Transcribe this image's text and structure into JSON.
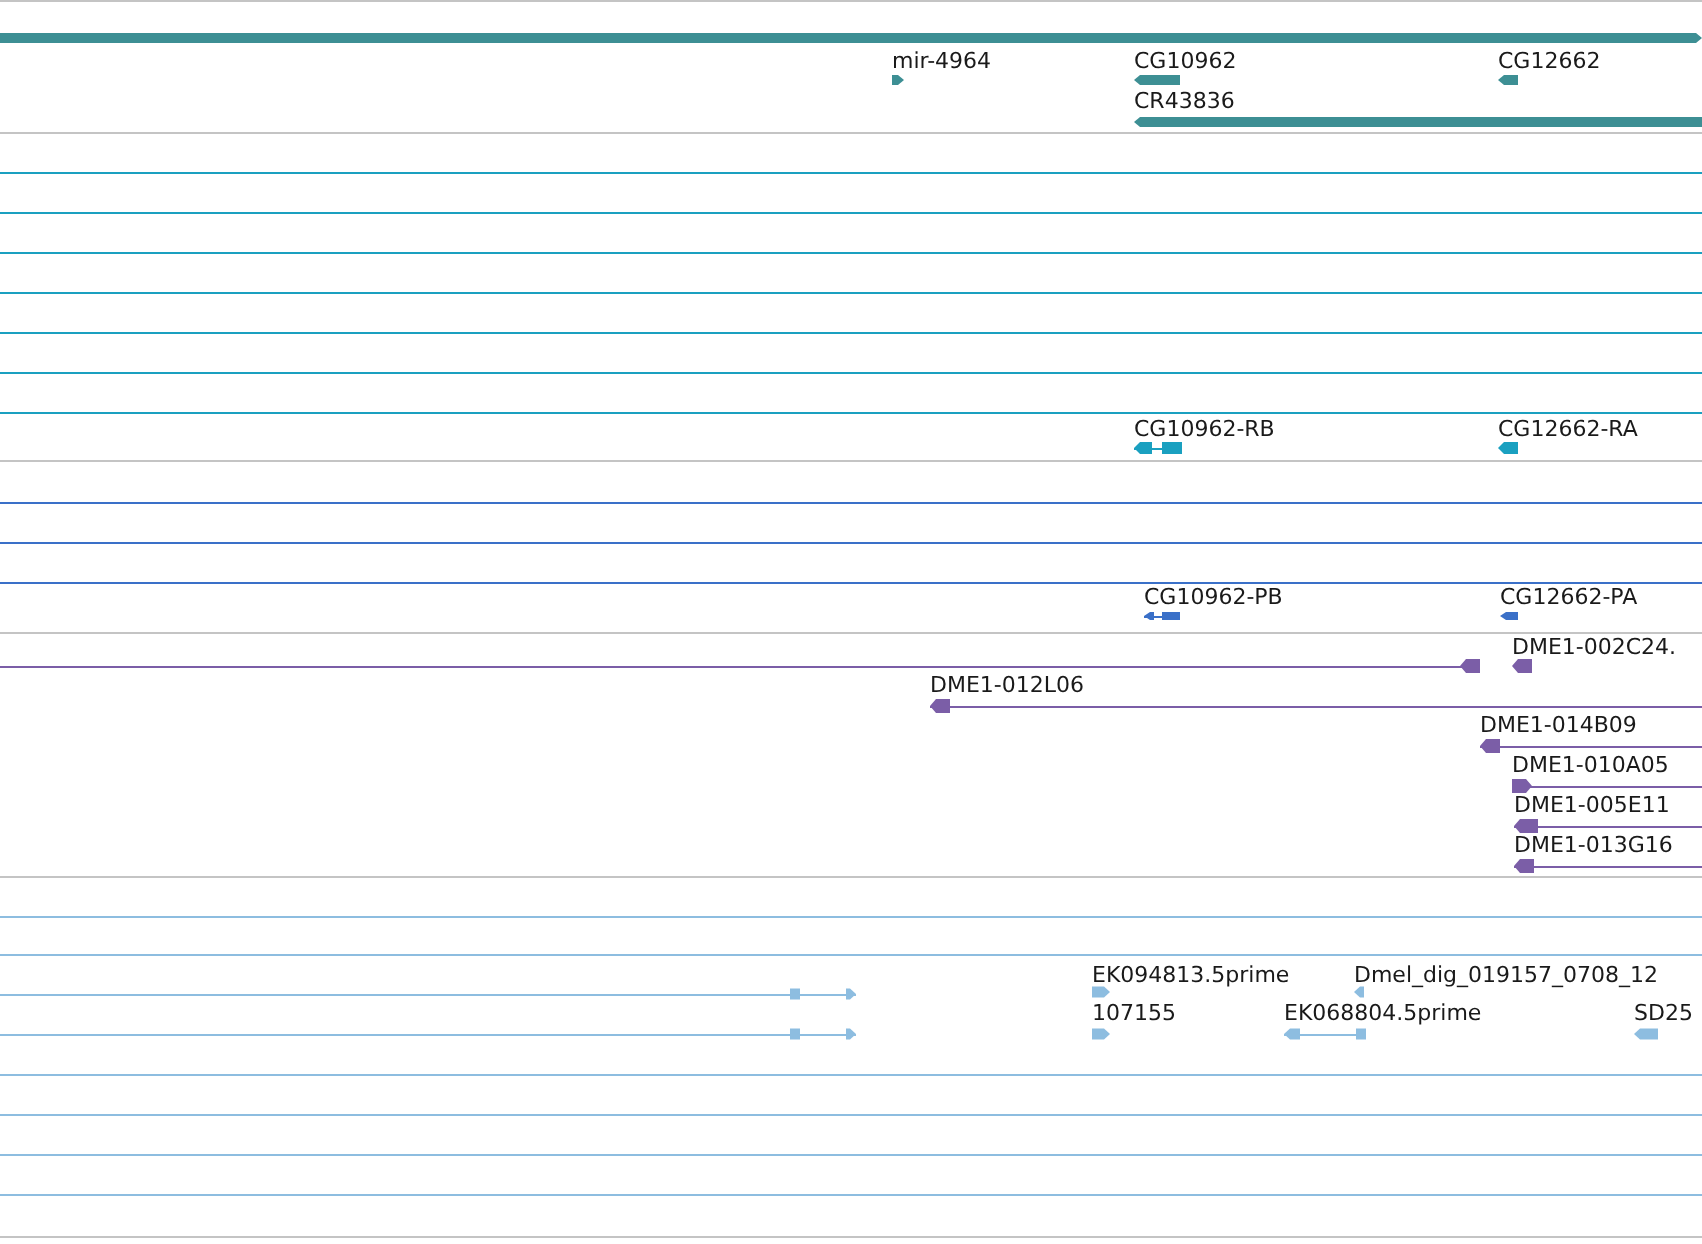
{
  "tracks": [
    {
      "kind": "gene",
      "color": "#3d8f94",
      "features": [
        {
          "reverse": false
        },
        {
          "label": "mir-4964",
          "reverse": false
        },
        {
          "label": "CG10962",
          "reverse": true
        },
        {
          "label": "CG12662",
          "reverse": true
        },
        {
          "label": "CR43836",
          "reverse": true
        }
      ]
    },
    {
      "kind": "transcript",
      "color": "#1aa0c0",
      "features": [
        {
          "label": "CG10962-RB",
          "reverse": true
        },
        {
          "label": "CG12662-RA",
          "reverse": true
        }
      ]
    },
    {
      "kind": "protein",
      "color": "#3a70c8",
      "features": [
        {
          "label": "CG10962-PB",
          "reverse": true
        },
        {
          "label": "CG12662-PA",
          "reverse": true
        }
      ]
    },
    {
      "kind": "clone",
      "color": "#7b5ea7",
      "features": [
        {
          "reverse": true
        },
        {
          "label": "DME1-002C24.",
          "reverse": true
        },
        {
          "label": "DME1-012L06",
          "reverse": true
        },
        {
          "label": "DME1-014B09",
          "reverse": true
        },
        {
          "label": "DME1-010A05",
          "reverse": false
        },
        {
          "label": "DME1-005E11",
          "reverse": true
        },
        {
          "label": "DME1-013G16",
          "reverse": true
        }
      ]
    },
    {
      "kind": "est",
      "color": "#8dbde0",
      "features": [
        {
          "reverse": false
        },
        {
          "label": "EK094813.5prime",
          "reverse": false
        },
        {
          "label": "Dmel_dig_019157_0708_12",
          "reverse": true
        },
        {
          "reverse": false
        },
        {
          "label": "107155",
          "reverse": false
        },
        {
          "label": "EK068804.5prime",
          "reverse": true
        },
        {
          "label": "SD25",
          "reverse": true
        }
      ]
    }
  ]
}
